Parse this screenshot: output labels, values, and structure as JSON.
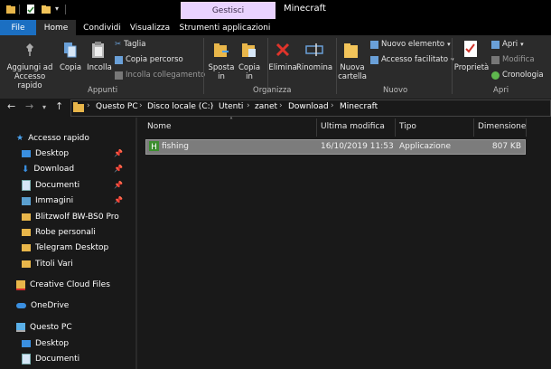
{
  "window": {
    "context_tab": "Gestisci",
    "title": "Minecraft"
  },
  "tabs": [
    "File",
    "Home",
    "Condividi",
    "Visualizza",
    "Strumenti applicazioni"
  ],
  "ribbon": {
    "appunti": {
      "pin_label": "Aggiungi ad\nAccesso rapido",
      "copy_label": "Copia",
      "paste_label": "Incolla",
      "cut_label": "Taglia",
      "copy_path_label": "Copia percorso",
      "paste_shortcut_label": "Incolla collegamento",
      "group_label": "Appunti"
    },
    "organizza": {
      "move_label": "Sposta\nin",
      "copy_to_label": "Copia\nin",
      "delete_label": "Elimina",
      "rename_label": "Rinomina",
      "group_label": "Organizza"
    },
    "nuovo": {
      "new_folder_label": "Nuova\ncartella",
      "new_item_label": "Nuovo elemento",
      "easy_access_label": "Accesso facilitato",
      "group_label": "Nuovo"
    },
    "apri": {
      "properties_label": "Proprietà",
      "open_label": "Apri",
      "edit_label": "Modifica",
      "history_label": "Cronologia",
      "group_label": "Apri"
    }
  },
  "address": {
    "crumbs": [
      "Questo PC",
      "Disco locale (C:)",
      "Utenti",
      "zanet",
      "Download",
      "Minecraft"
    ]
  },
  "sidebar": {
    "items": [
      {
        "label": "Accesso rapido",
        "icon": "star-icon",
        "pinned": false
      },
      {
        "label": "Desktop",
        "icon": "desktop-folder-icon",
        "pinned": true
      },
      {
        "label": "Download",
        "icon": "download-icon",
        "pinned": true
      },
      {
        "label": "Documenti",
        "icon": "documents-icon",
        "pinned": true
      },
      {
        "label": "Immagini",
        "icon": "pictures-icon",
        "pinned": true
      },
      {
        "label": "Blitzwolf BW-BS0 Pro",
        "icon": "folder-icon",
        "pinned": false
      },
      {
        "label": "Robe personali",
        "icon": "folder-icon",
        "pinned": false
      },
      {
        "label": "Telegram Desktop",
        "icon": "folder-icon",
        "pinned": false
      },
      {
        "label": "Titoli Vari",
        "icon": "folder-icon",
        "pinned": false
      },
      {
        "label": "Creative Cloud Files",
        "icon": "creative-cloud-icon",
        "pinned": false
      },
      {
        "label": "OneDrive",
        "icon": "onedrive-icon",
        "pinned": false
      },
      {
        "label": "Questo PC",
        "icon": "computer-icon",
        "pinned": false
      },
      {
        "label": "Desktop",
        "icon": "desktop-folder-icon",
        "pinned": false
      },
      {
        "label": "Documenti",
        "icon": "documents-icon",
        "pinned": false
      }
    ]
  },
  "columns": [
    "Nome",
    "Ultima modifica",
    "Tipo",
    "Dimensione"
  ],
  "files": [
    {
      "name": "fishing",
      "modified": "16/10/2019 11:53",
      "type": "Applicazione",
      "size": "807 KB",
      "icon": "app-icon"
    }
  ],
  "colors": {
    "accent": "#1b6fc2",
    "context": "#e9d2ff",
    "background": "#191919",
    "ribbon": "#2b2b2b",
    "selection": "#7c7c7c"
  }
}
